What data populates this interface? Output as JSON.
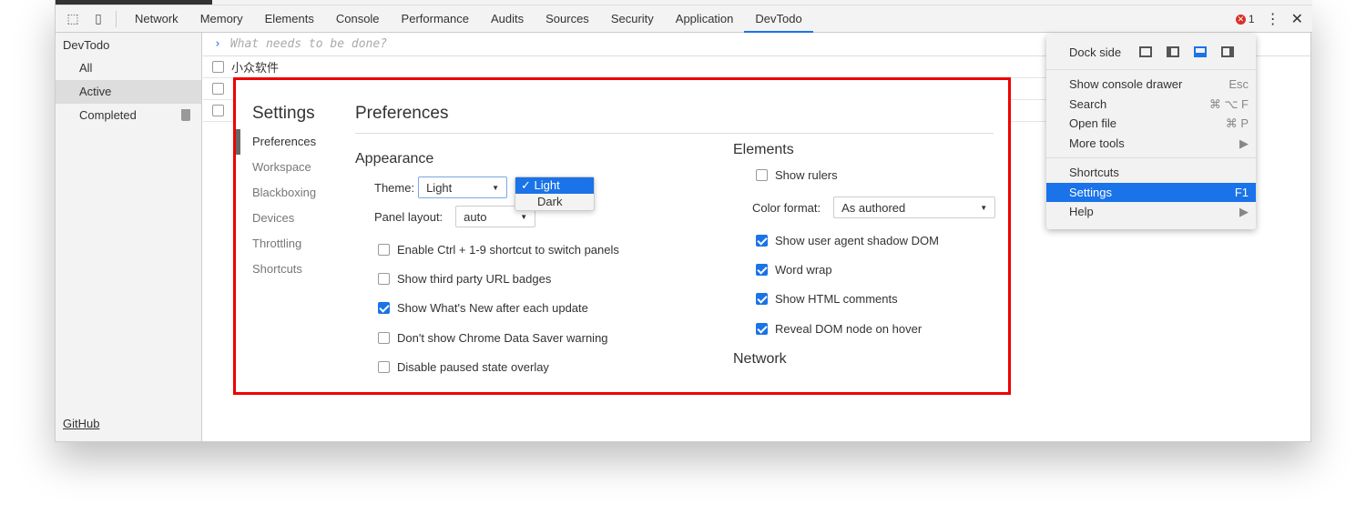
{
  "tabs": [
    "Network",
    "Memory",
    "Elements",
    "Console",
    "Performance",
    "Audits",
    "Sources",
    "Security",
    "Application",
    "DevTodo"
  ],
  "active_tab": "DevTodo",
  "error_count": "1",
  "sidebar": {
    "title": "DevTodo",
    "items": [
      "All",
      "Active",
      "Completed"
    ],
    "selected": "Active",
    "footer": "GitHub"
  },
  "todo": {
    "placeholder": "What needs to be done?",
    "items": [
      "小众软件",
      "",
      ""
    ]
  },
  "settings": {
    "title": "Settings",
    "nav": [
      "Preferences",
      "Workspace",
      "Blackboxing",
      "Devices",
      "Throttling",
      "Shortcuts"
    ],
    "page_title": "Preferences",
    "appearance": {
      "heading": "Appearance",
      "theme_label": "Theme:",
      "theme_options": [
        "Light",
        "Dark"
      ],
      "theme_selected": "Light",
      "panel_layout_label": "Panel layout:",
      "panel_layout_value": "auto",
      "checks": [
        {
          "label": "Enable Ctrl + 1-9 shortcut to switch panels",
          "checked": false
        },
        {
          "label": "Show third party URL badges",
          "checked": false
        },
        {
          "label": "Show What's New after each update",
          "checked": true
        },
        {
          "label": "Don't show Chrome Data Saver warning",
          "checked": false
        },
        {
          "label": "Disable paused state overlay",
          "checked": false
        }
      ]
    },
    "elements": {
      "heading": "Elements",
      "show_rulers": {
        "label": "Show rulers",
        "checked": false
      },
      "color_format_label": "Color format:",
      "color_format_value": "As authored",
      "checks": [
        {
          "label": "Show user agent shadow DOM",
          "checked": true
        },
        {
          "label": "Word wrap",
          "checked": true
        },
        {
          "label": "Show HTML comments",
          "checked": true
        },
        {
          "label": "Reveal DOM node on hover",
          "checked": true
        }
      ]
    },
    "network_heading": "Network"
  },
  "menu": {
    "dock_side": "Dock side",
    "dock_selected": "bottom",
    "items": [
      {
        "label": "Show console drawer",
        "shortcut": "Esc"
      },
      {
        "label": "Search",
        "shortcut": "⌘ ⌥ F"
      },
      {
        "label": "Open file",
        "shortcut": "⌘ P"
      },
      {
        "label": "More tools",
        "shortcut": "▶"
      },
      {
        "label": "Shortcuts",
        "shortcut": ""
      },
      {
        "label": "Settings",
        "shortcut": "F1"
      },
      {
        "label": "Help",
        "shortcut": "▶"
      }
    ],
    "highlighted": "Settings"
  },
  "colors": {
    "accent": "#1a73e8",
    "highlight_box": "#e00000",
    "error": "#d93025"
  }
}
